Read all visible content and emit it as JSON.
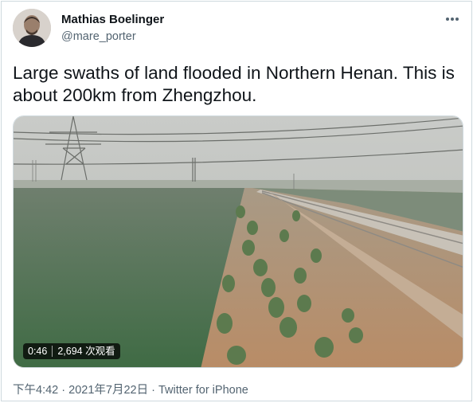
{
  "author": {
    "name": "Mathias Boelinger",
    "handle": "@mare_porter",
    "avatar_icon": "person-avatar"
  },
  "more_icon": "more-dots-icon",
  "tweet_text": "Large swaths of land flooded in Northern Henan. This is about 200km from Zhengzhou.",
  "video": {
    "duration": "0:46",
    "views": "2,694 次观看",
    "scene": "flooded-landscape-video-frame"
  },
  "meta": {
    "time": "下午4:42",
    "separator_1": "·",
    "date": "2021年7月22日",
    "separator_2": "·",
    "source": "Twitter for iPhone"
  },
  "colors": {
    "text": "#0f1419",
    "secondary": "#536471",
    "border": "#cfd9de"
  }
}
